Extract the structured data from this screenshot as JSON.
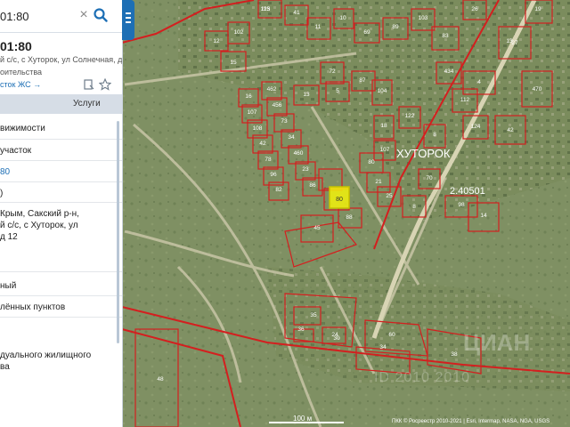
{
  "search": {
    "value": "01:80"
  },
  "object": {
    "title": "01:80",
    "address_short": "й с/с, с Хуторок, ул Солнечная, д 12",
    "purpose": "оительства",
    "link": "сток ЖС →"
  },
  "tabs": {
    "services": "Услуги"
  },
  "details": [
    {
      "text": "вижимости"
    },
    {
      "text": "участок"
    },
    {
      "text": "80",
      "blue": true
    },
    {
      "text": ")"
    },
    {
      "text": "Крым, Сакский р-н,"
    },
    {
      "text": "й с/с, с Хуторок, ул"
    },
    {
      "text": "д 12"
    },
    {
      "text": "ный"
    },
    {
      "text": "лённых пунктов"
    },
    {
      "text": "дуального жилищного"
    },
    {
      "text": "ва"
    }
  ],
  "map": {
    "village_label": "ХУТОРОК",
    "cadastral_label": "2.40501",
    "selected_parcel": "80",
    "parcel_numbers": [
      "123",
      "41",
      "11",
      "10",
      "69",
      "89",
      "103",
      "83",
      "26",
      "19",
      "13",
      "12",
      "102",
      "15",
      "16",
      "107",
      "108",
      "42",
      "78",
      "96",
      "82",
      "462",
      "456",
      "73",
      "34",
      "460",
      "23",
      "86",
      "13",
      "72",
      "5",
      "87",
      "104",
      "18",
      "107",
      "80",
      "21",
      "25",
      "122",
      "8",
      "70",
      "8",
      "98",
      "14",
      "112",
      "124",
      "434",
      "4",
      "42",
      "470",
      "27",
      "45",
      "88",
      "36",
      "24",
      "35",
      "60",
      "30",
      "34",
      "38",
      "48",
      "115"
    ],
    "scale_label": "100 м",
    "attribution": "ПКК © Росреестр 2010-2021 | Esri, Intermap, NASA, NGA, USGS",
    "watermark": "ЦИАН",
    "watermark_sub": "ID 2010 2010"
  },
  "colors": {
    "accent": "#1d6fb5",
    "parcel_border": "#d41f1f",
    "selected_fill": "#f2f20a",
    "panel_header": "#d6dde6"
  }
}
